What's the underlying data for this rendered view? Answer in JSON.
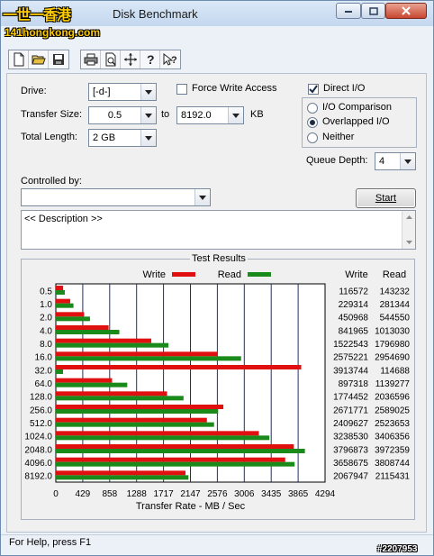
{
  "window": {
    "title": "Disk Benchmark",
    "watermark_line1": "一世一香港",
    "watermark_line2": "141hongkong.com",
    "corner_watermark": "#2207953"
  },
  "toolbar": {
    "icons": [
      "new-document-icon",
      "open-folder-icon",
      "save-icon",
      "print-icon",
      "print-preview-icon",
      "move-icon",
      "help-icon",
      "context-help-icon"
    ]
  },
  "form": {
    "drive_label": "Drive:",
    "drive_value": "[-d-]",
    "force_write_label": "Force Write Access",
    "force_write_checked": false,
    "direct_io_label": "Direct I/O",
    "direct_io_checked": true,
    "transfer_size_label": "Transfer Size:",
    "transfer_size_from": "0.5",
    "to_label": "to",
    "transfer_size_to": "8192.0",
    "kb_label": "KB",
    "total_length_label": "Total Length:",
    "total_length_value": "2 GB",
    "io_comparison_label": "I/O Comparison",
    "overlapped_io_label": "Overlapped I/O",
    "neither_label": "Neither",
    "selected_mode": "Overlapped I/O",
    "queue_depth_label": "Queue Depth:",
    "queue_depth_value": "4",
    "controlled_by_label": "Controlled by:",
    "controlled_by_value": "",
    "start_button": "Start",
    "description": "<< Description >>"
  },
  "results": {
    "title": "Test Results",
    "legend_write": "Write",
    "legend_read": "Read",
    "col_write": "Write",
    "col_read": "Read",
    "rows": [
      {
        "size": "0.5",
        "write": "116572",
        "read": "143232"
      },
      {
        "size": "1.0",
        "write": "229314",
        "read": "281344"
      },
      {
        "size": "2.0",
        "write": "450968",
        "read": "544550"
      },
      {
        "size": "4.0",
        "write": "841965",
        "read": "1013030"
      },
      {
        "size": "8.0",
        "write": "1522543",
        "read": "1796980"
      },
      {
        "size": "16.0",
        "write": "2575221",
        "read": "2954690"
      },
      {
        "size": "32.0",
        "write": "3913744",
        "read": "114688"
      },
      {
        "size": "64.0",
        "write": "897318",
        "read": "1139277"
      },
      {
        "size": "128.0",
        "write": "1774452",
        "read": "2036596"
      },
      {
        "size": "256.0",
        "write": "2671771",
        "read": "2589025"
      },
      {
        "size": "512.0",
        "write": "2409627",
        "read": "2523653"
      },
      {
        "size": "1024.0",
        "write": "3238530",
        "read": "3406356"
      },
      {
        "size": "2048.0",
        "write": "3796873",
        "read": "3972359"
      },
      {
        "size": "4096.0",
        "write": "3658675",
        "read": "3808744"
      },
      {
        "size": "8192.0",
        "write": "2067947",
        "read": "2115431"
      }
    ]
  },
  "chart_data": {
    "type": "bar",
    "orientation": "horizontal",
    "title": "Test Results",
    "xlabel": "Transfer Rate - MB / Sec",
    "ylabel": "",
    "categories": [
      "0.5",
      "1.0",
      "2.0",
      "4.0",
      "8.0",
      "16.0",
      "32.0",
      "64.0",
      "128.0",
      "256.0",
      "512.0",
      "1024.0",
      "2048.0",
      "4096.0",
      "8192.0"
    ],
    "x_ticks": [
      "0",
      "429",
      "858",
      "1288",
      "1717",
      "2147",
      "2576",
      "3006",
      "3435",
      "3865",
      "4294"
    ],
    "xlim": [
      0,
      4294
    ],
    "series": [
      {
        "name": "Write",
        "color": "#e01010",
        "values": [
          116.6,
          229.3,
          451.0,
          842.0,
          1522.5,
          2575.2,
          3913.7,
          897.3,
          1774.5,
          2671.8,
          2409.6,
          3238.5,
          3796.9,
          3658.7,
          2067.9
        ]
      },
      {
        "name": "Read",
        "color": "#1a8a1a",
        "values": [
          143.2,
          281.3,
          544.6,
          1013.0,
          1797.0,
          2954.7,
          114.7,
          1139.3,
          2036.6,
          2589.0,
          2523.7,
          3406.4,
          3972.4,
          3808.7,
          2115.4
        ]
      }
    ],
    "legend_position": "top",
    "grid": true
  },
  "status": {
    "text": "For Help, press F1"
  }
}
